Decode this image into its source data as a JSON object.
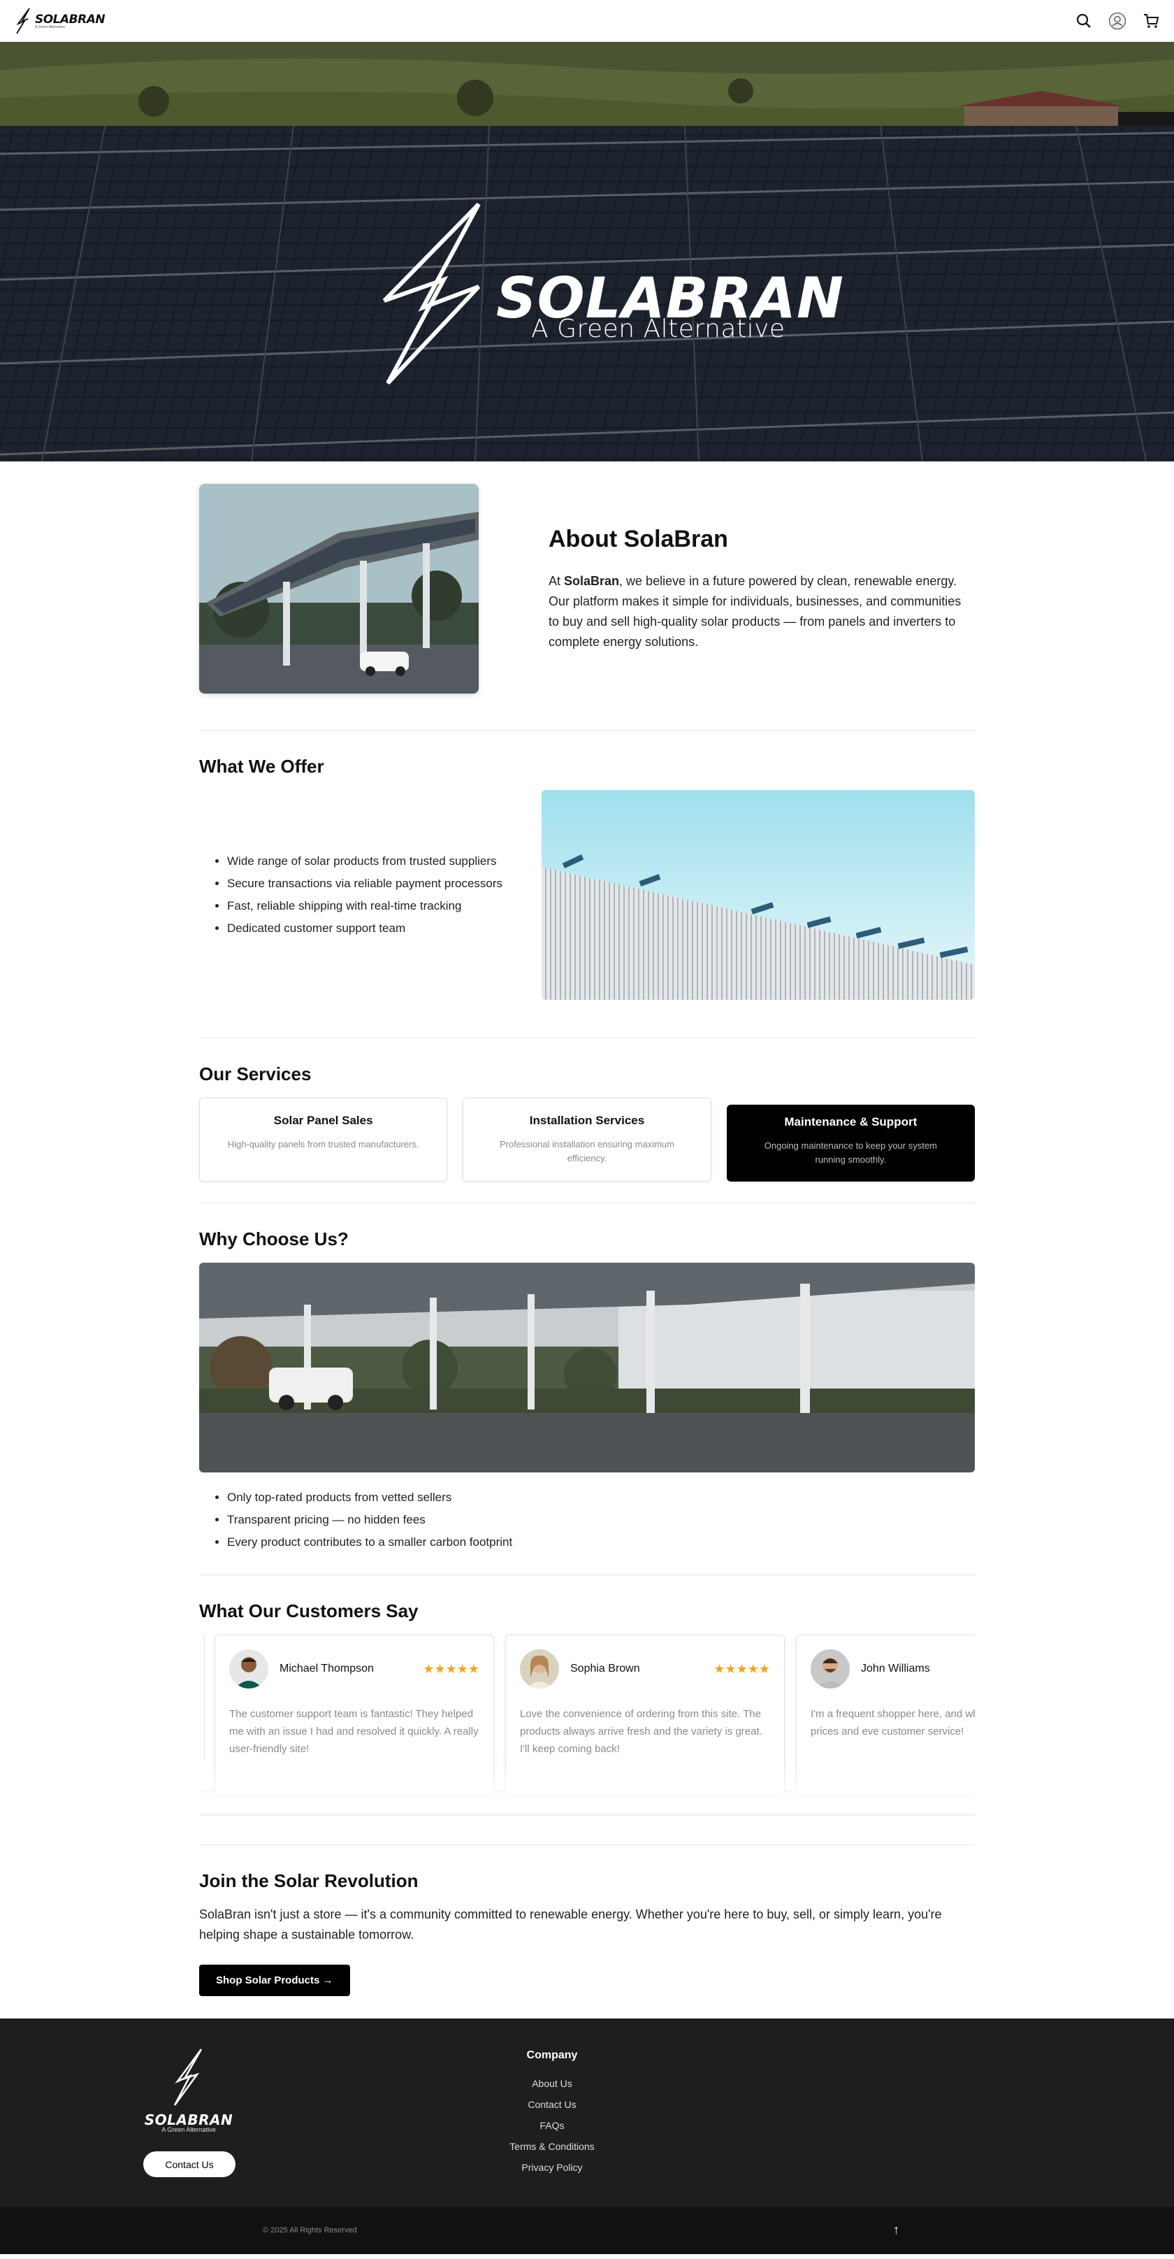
{
  "header": {
    "brand": "SOLABRAN",
    "tagline": "A Green Alternative"
  },
  "hero": {
    "title": "SOLABRAN",
    "subtitle": "A Green Alternative"
  },
  "about": {
    "heading": "About SolaBran",
    "text_prefix": "At ",
    "text_bold": "SolaBran",
    "text_rest": ", we believe in a future powered by clean, renewable energy. Our platform makes it simple for individuals, businesses, and communities to buy and sell high-quality solar products — from panels and inverters to complete energy solutions."
  },
  "offer": {
    "heading": "What We Offer",
    "items": [
      "Wide range of solar products from trusted suppliers",
      "Secure transactions via reliable payment processors",
      "Fast, reliable shipping with real-time tracking",
      "Dedicated customer support team"
    ]
  },
  "services": {
    "heading": "Our Services",
    "cards": [
      {
        "title": "Solar Panel Sales",
        "desc": "High-quality panels from trusted manufacturers."
      },
      {
        "title": "Installation Services",
        "desc": "Professional installation ensuring maximum efficiency."
      },
      {
        "title": "Maintenance & Support",
        "desc": "Ongoing maintenance to keep your system running smoothly."
      }
    ]
  },
  "why": {
    "heading": "Why Choose Us?",
    "items": [
      "Only top-rated products from vetted sellers",
      "Transparent pricing — no hidden fees",
      "Every product contributes to a smaller carbon footprint"
    ]
  },
  "testimonials": {
    "heading": "What Our Customers Say",
    "stars": "★★★★★",
    "items": [
      {
        "name": "Michael Thompson",
        "quote": "The customer support team is fantastic! They helped me with an issue I had and resolved it quickly. A really user-friendly site!"
      },
      {
        "name": "Sophia Brown",
        "quote": "Love the convenience of ordering from this site. The products always arrive fresh and the variety is great. I'll keep coming back!"
      },
      {
        "name": "John Williams",
        "quote": "I'm a frequent shopper here, and what I need. Great prices and eve customer service!"
      }
    ]
  },
  "join": {
    "heading": "Join the Solar Revolution",
    "text": "SolaBran isn't just a store — it's a community committed to renewable energy. Whether you're here to buy, sell, or simply learn, you're helping shape a sustainable tomorrow.",
    "button": "Shop Solar Products →"
  },
  "footer": {
    "brand": "SOLABRAN",
    "tagline": "A Green Alternative",
    "contact_button": "Contact Us",
    "company_heading": "Company",
    "links": [
      "About Us",
      "Contact Us",
      "FAQs",
      "Terms & Conditions",
      "Privacy Policy"
    ],
    "copyright": "© 2025 All Rights Reserved",
    "back_to_top": "↑"
  },
  "colors": {
    "star": "#f2a41d",
    "footer_bg": "#1e1e1e",
    "bottom_bar": "#111111",
    "accent_dark": "#000000"
  }
}
